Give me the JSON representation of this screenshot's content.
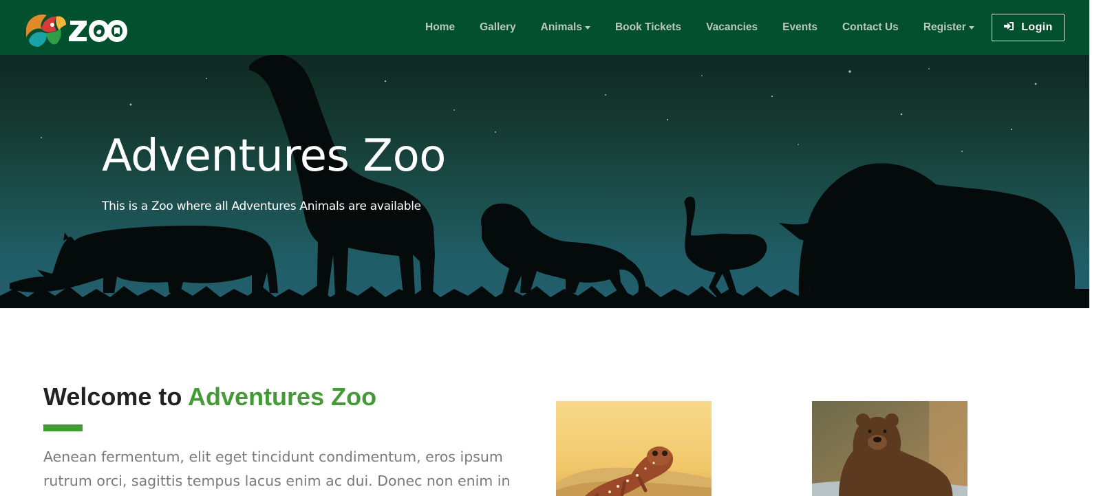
{
  "brand": {
    "name": "ZOO"
  },
  "nav": {
    "items": [
      {
        "label": "Home",
        "dropdown": false
      },
      {
        "label": "Gallery",
        "dropdown": false
      },
      {
        "label": "Animals",
        "dropdown": true
      },
      {
        "label": "Book Tickets",
        "dropdown": false
      },
      {
        "label": "Vacancies",
        "dropdown": false
      },
      {
        "label": "Events",
        "dropdown": false
      },
      {
        "label": "Contact Us",
        "dropdown": false
      },
      {
        "label": "Register",
        "dropdown": true
      }
    ],
    "login_label": "Login",
    "login_icon": "sign-in-icon"
  },
  "hero": {
    "title": "Adventures Zoo",
    "subtitle": "This is a Zoo where all Adventures Animals are available"
  },
  "welcome": {
    "heading_prefix": "Welcome to",
    "heading_accent": "Adventures Zoo",
    "body": "Aenean fermentum, elit eget tincidunt condimentum, eros ipsum rutrum orci, sagittis tempus lacus enim ac dui. Donec non enim in turpis pulvinar"
  },
  "colors": {
    "navbar": "#03502f",
    "nav_text": "#b9c9c0",
    "accent": "#439a36",
    "heading": "#222222",
    "body_text": "#7a7a7a"
  }
}
